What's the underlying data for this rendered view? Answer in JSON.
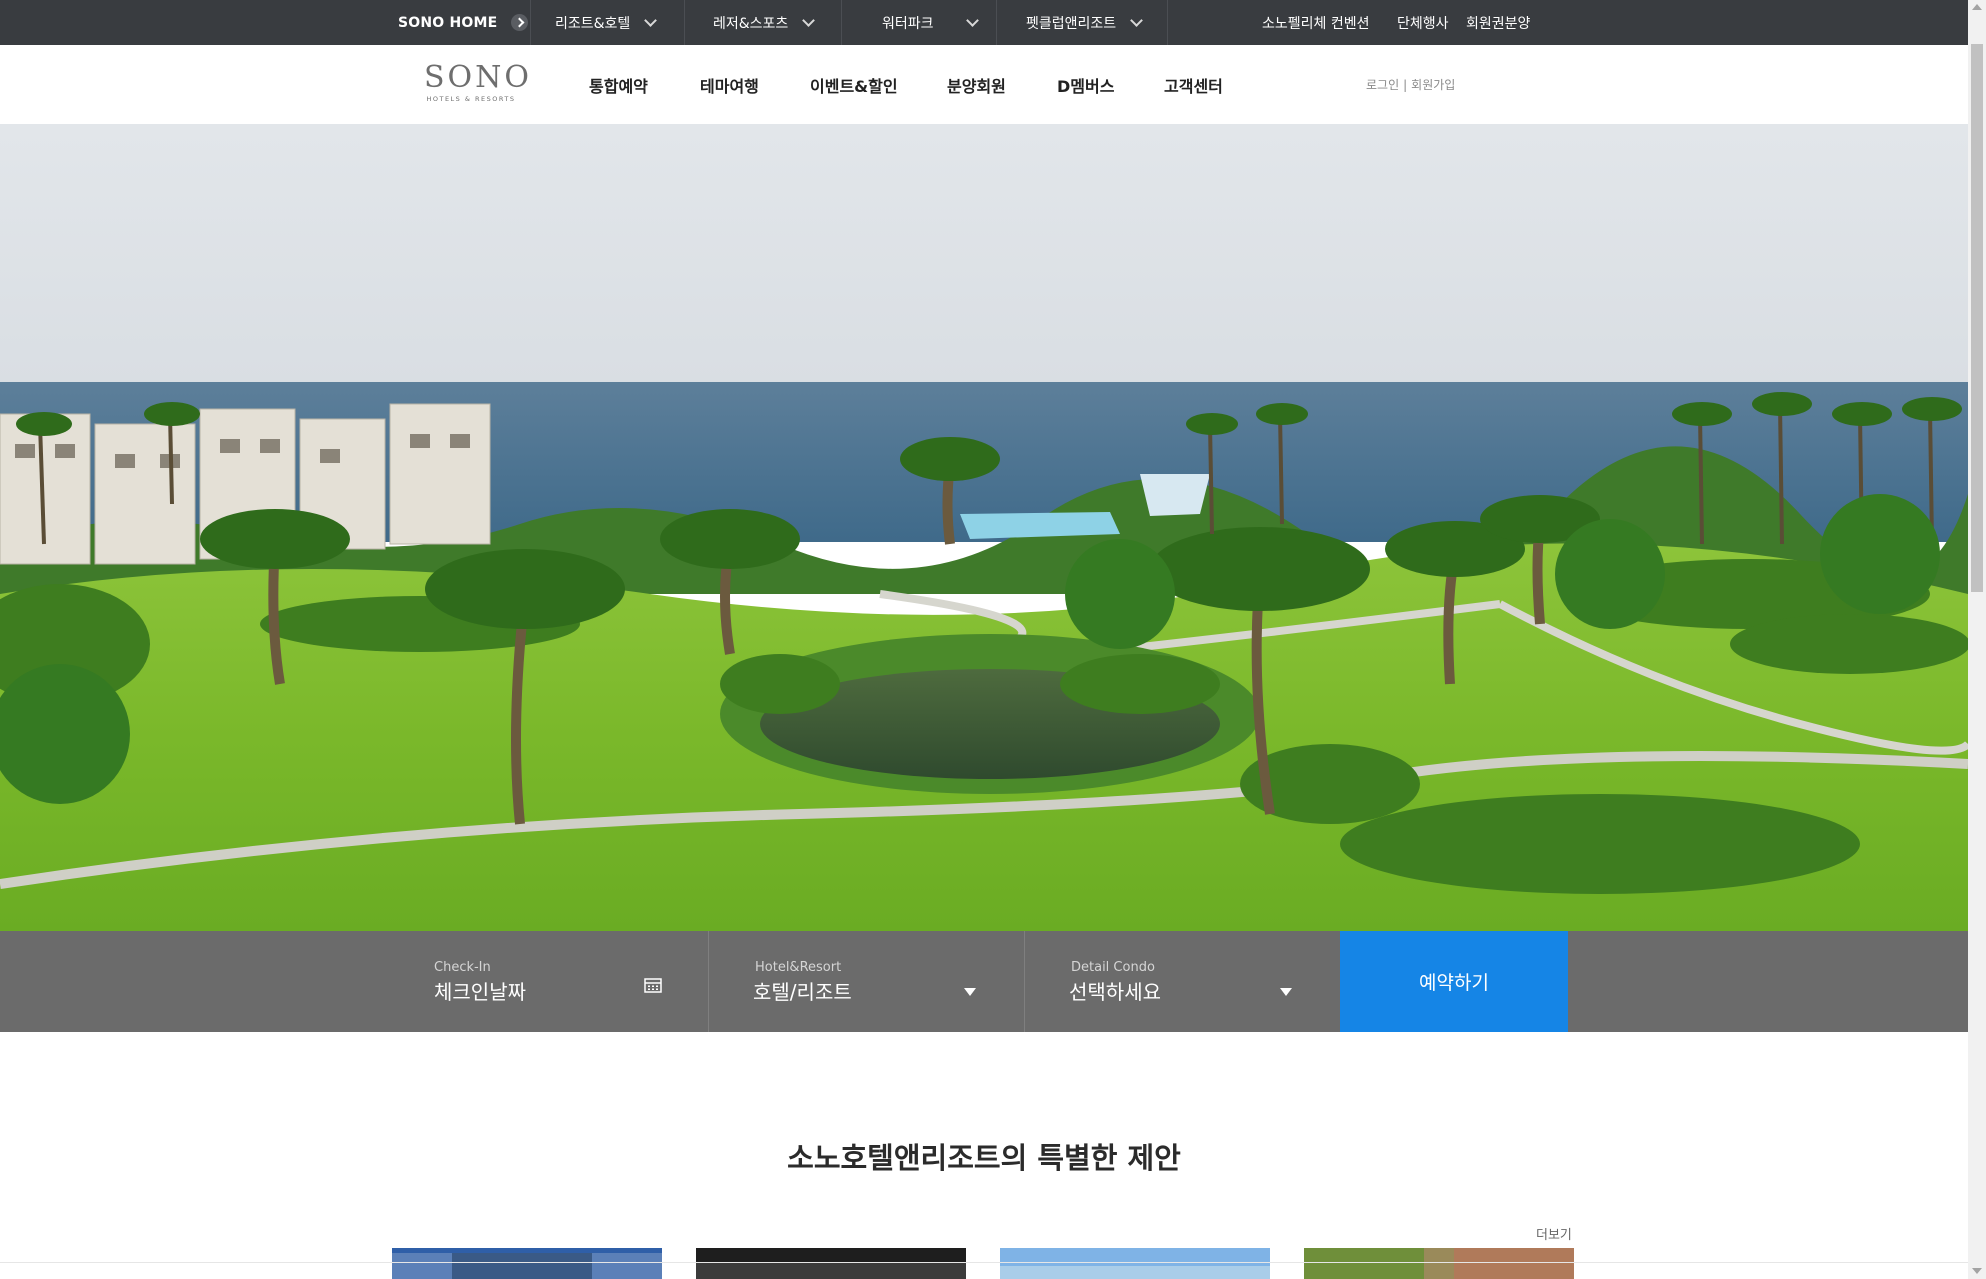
{
  "topbar": {
    "home": "SONO HOME",
    "menus": [
      {
        "label": "리조트&호텔"
      },
      {
        "label": "레저&스포츠"
      },
      {
        "label": "워터파크"
      },
      {
        "label": "펫클럽앤리조트"
      }
    ],
    "links": [
      "소노펠리체 컨벤션",
      "단체행사",
      "회원권분양"
    ]
  },
  "header": {
    "logo_main": "SONO",
    "logo_sub": "HOTELS & RESORTS",
    "nav": [
      "통합예약",
      "테마여행",
      "이벤트&할인",
      "분양회원",
      "D멤버스",
      "고객센터"
    ],
    "login": "로그인",
    "divider": "|",
    "signup": "회원가입"
  },
  "booking": {
    "checkin_label": "Check-In",
    "checkin_value": "체크인날짜",
    "hotel_label": "Hotel&Resort",
    "hotel_value": "호텔/리조트",
    "condo_label": "Detail Condo",
    "condo_value": "선택하세요",
    "reserve_button": "예약하기"
  },
  "offers": {
    "title": "소노호텔앤리조트의 특별한 제안",
    "more": "더보기"
  },
  "colors": {
    "topbar_bg": "#393c40",
    "booking_bg": "#6b6b6b",
    "accent": "#1585e6"
  }
}
